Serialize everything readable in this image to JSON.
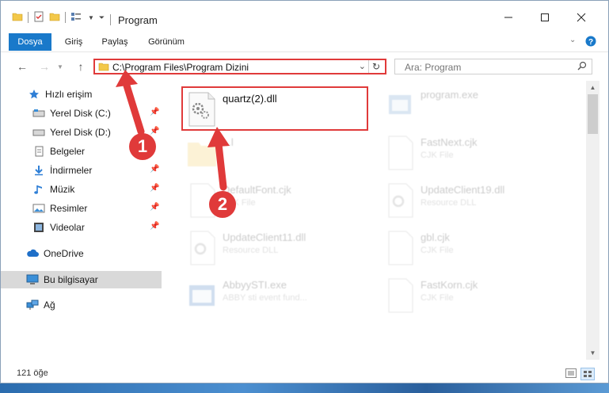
{
  "window": {
    "title": "Program"
  },
  "ribbon": {
    "tabs": [
      "Dosya",
      "Giriş",
      "Paylaş",
      "Görünüm"
    ]
  },
  "address": {
    "path": "C:\\Program Files\\Program Dizini"
  },
  "search": {
    "placeholder": "Ara: Program"
  },
  "sidebar": {
    "quick_access": "Hızlı erişim",
    "items": [
      {
        "label": "Yerel Disk (C:)",
        "pinned": true
      },
      {
        "label": "Yerel Disk (D:)",
        "pinned": true
      },
      {
        "label": "Belgeler",
        "pinned": false
      },
      {
        "label": "İndirmeler",
        "pinned": true
      },
      {
        "label": "Müzik",
        "pinned": true
      },
      {
        "label": "Resimler",
        "pinned": true
      },
      {
        "label": "Videolar",
        "pinned": true
      }
    ],
    "onedrive": "OneDrive",
    "this_pc": "Bu bilgisayar",
    "network": "Ağ"
  },
  "files": [
    {
      "name": "quartz(2).dll",
      "type": ""
    },
    {
      "name": "program.exe",
      "type": ""
    },
    {
      "name": "...l",
      "type": ""
    },
    {
      "name": "FastNext.cjk",
      "type": "CJK File"
    },
    {
      "name": "DefaultFont.cjk",
      "type": "CJK File"
    },
    {
      "name": "UpdateClient19.dll",
      "type": "Resource DLL"
    },
    {
      "name": "UpdateClient11.dll",
      "type": "Resource DLL"
    },
    {
      "name": "gbl.cjk",
      "type": "CJK File"
    },
    {
      "name": "AbbyySTI.exe",
      "type": "ABBY sti event fund..."
    },
    {
      "name": "FastKorn.cjk",
      "type": "CJK File"
    }
  ],
  "status": {
    "item_count": "121 öğe"
  },
  "annotations": {
    "step1": "1",
    "step2": "2"
  },
  "colors": {
    "accent": "#1979ca",
    "highlight": "#e03a3a"
  }
}
